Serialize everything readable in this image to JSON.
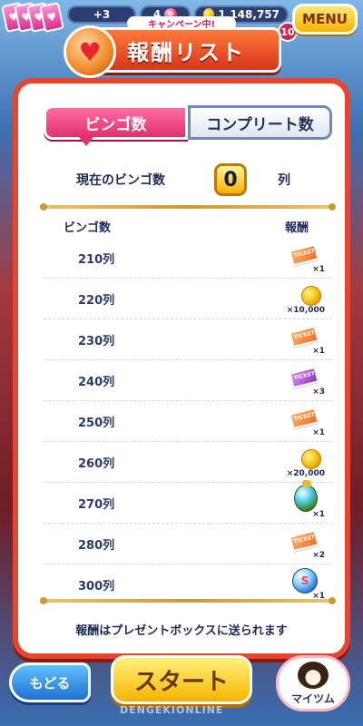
{
  "hud": {
    "hearts_bonus": "+3",
    "ruby_count": "4",
    "coin_count": "1,148,757",
    "level": "10",
    "menu_label": "MENU"
  },
  "header": {
    "campaign": "キャンペーン中!",
    "title": "報酬リスト"
  },
  "tabs": [
    {
      "label": "ビンゴ数",
      "active": true
    },
    {
      "label": "コンプリート数",
      "active": false
    }
  ],
  "current": {
    "label": "現在のビンゴ数",
    "value": "0",
    "unit": "列"
  },
  "columns": {
    "left": "ビンゴ数",
    "right": "報酬"
  },
  "rewards": [
    {
      "label": "210列",
      "item": "ticket-orange-icon",
      "qty": "×1"
    },
    {
      "label": "220列",
      "item": "coin-icon",
      "qty": "×10,000"
    },
    {
      "label": "230列",
      "item": "ticket-orange-icon",
      "qty": "×1"
    },
    {
      "label": "240列",
      "item": "ticket-purple-icon",
      "qty": "×3"
    },
    {
      "label": "250列",
      "item": "ticket-orange-icon",
      "qty": "×1"
    },
    {
      "label": "260列",
      "item": "coin-icon",
      "qty": "×20,000"
    },
    {
      "label": "270列",
      "item": "potion-icon",
      "qty": "×1"
    },
    {
      "label": "280列",
      "item": "ticket-orange-icon",
      "qty": "×2"
    },
    {
      "label": "300列",
      "item": "blue-orb-icon",
      "qty": "×1"
    }
  ],
  "footnote": "報酬はプレゼントボックスに送られます",
  "bottom": {
    "back_label": "もどる",
    "start_label": "スタート",
    "my_tsum_label": "マイツム"
  },
  "watermark": "DENGEKIONLINE"
}
